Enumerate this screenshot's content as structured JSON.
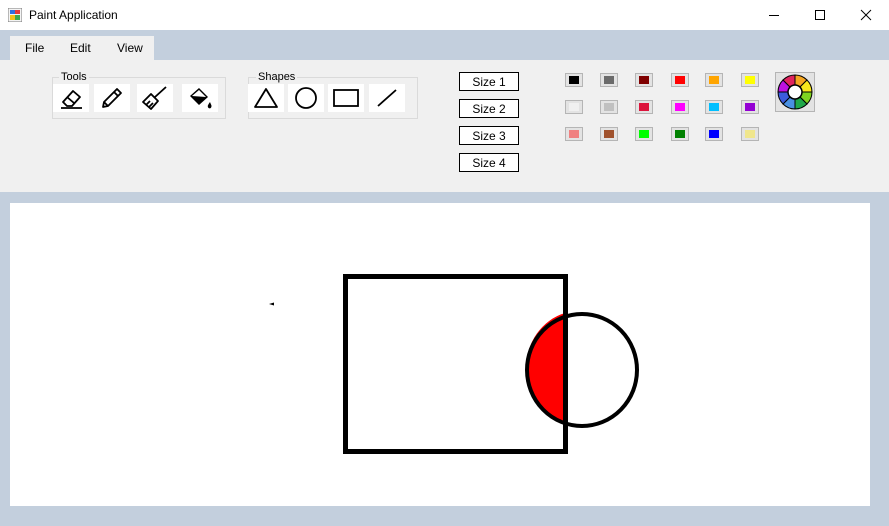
{
  "window": {
    "title": "Paint Application",
    "app_icon": "paint-app-icon"
  },
  "menu": {
    "items": [
      "File",
      "Edit",
      "View"
    ]
  },
  "tools": {
    "label": "Tools",
    "items": [
      "eraser-icon",
      "pencil-icon",
      "brush-icon",
      "fill-bucket-icon"
    ]
  },
  "shapes": {
    "label": "Shapes",
    "items": [
      "triangle-icon",
      "circle-icon",
      "rectangle-icon",
      "line-icon"
    ]
  },
  "sizes": [
    "Size 1",
    "Size 2",
    "Size 3",
    "Size 4"
  ],
  "palette": {
    "colors": [
      "#000000",
      "#6b6b6b",
      "#800000",
      "#ff0000",
      "#ffa500",
      "#ffff00",
      "#f0f0f0",
      "#c0c0c0",
      "#dc143c",
      "#ff00ff",
      "#00bfff",
      "#9400d3",
      "#f08080",
      "#a0522d",
      "#00ff00",
      "#008000",
      "#0000ff",
      "#f0e68c"
    ],
    "picker_icon": "color-wheel-icon"
  },
  "drawing": {
    "stroke_color": "#000000",
    "fill_color": "#ff0000",
    "shapes": [
      "rectangle",
      "circle",
      "red-fill",
      "dot"
    ]
  }
}
